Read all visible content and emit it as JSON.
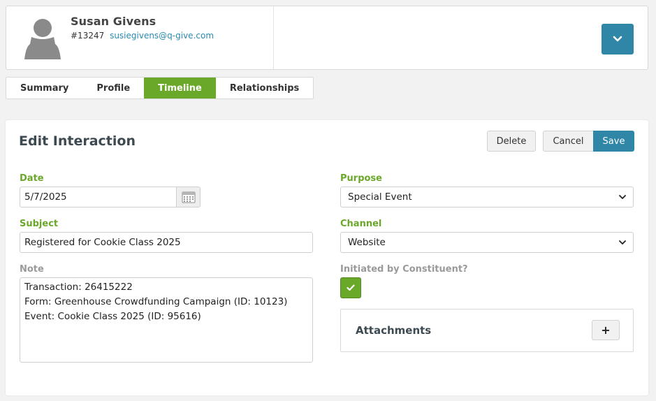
{
  "constituent": {
    "name": "Susan Givens",
    "id": "#13247",
    "email": "susiegivens@q-give.com"
  },
  "tabs": [
    {
      "label": "Summary",
      "active": false
    },
    {
      "label": "Profile",
      "active": false
    },
    {
      "label": "Timeline",
      "active": true
    },
    {
      "label": "Relationships",
      "active": false
    }
  ],
  "form": {
    "title": "Edit Interaction",
    "delete_label": "Delete",
    "cancel_label": "Cancel",
    "save_label": "Save",
    "date_label": "Date",
    "date_value": "5/7/2025",
    "subject_label": "Subject",
    "subject_value": "Registered for Cookie Class 2025",
    "note_label": "Note",
    "note_lines": [
      "Transaction: 26415222",
      "Form: Greenhouse Crowdfunding Campaign (ID: 10123)",
      "Event: Cookie Class 2025 (ID: 95616)"
    ],
    "purpose_label": "Purpose",
    "purpose_value": "Special Event",
    "channel_label": "Channel",
    "channel_value": "Website",
    "initiated_label": "Initiated by Constituent?",
    "initiated_checked": true,
    "attachments_label": "Attachments",
    "attachments_add_label": "+"
  },
  "colors": {
    "accent_green": "#6aa829",
    "accent_blue": "#2f86a6"
  }
}
